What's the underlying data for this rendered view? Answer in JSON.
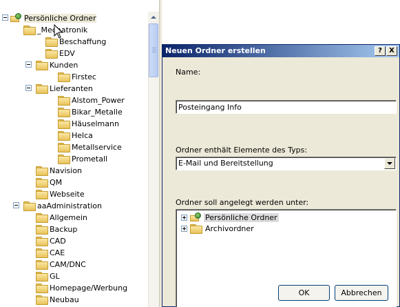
{
  "tree": {
    "items": [
      {
        "label": "Persönliche Ordner",
        "icon": "pst-icon",
        "expander": "minus"
      },
      {
        "label": "_Mechatronik",
        "icon": "folder-icon",
        "expander": "minus"
      },
      {
        "label": "Beschaffung",
        "icon": "folder-icon"
      },
      {
        "label": "EDV",
        "icon": "folder-icon"
      },
      {
        "label": "Kunden",
        "icon": "folder-icon",
        "expander": "minus"
      },
      {
        "label": "Firstec",
        "icon": "folder-icon"
      },
      {
        "label": "Lieferanten",
        "icon": "folder-icon",
        "expander": "minus"
      },
      {
        "label": "Alstom_Power",
        "icon": "folder-icon"
      },
      {
        "label": "Bikar_Metalle",
        "icon": "folder-icon"
      },
      {
        "label": "Häuselmann",
        "icon": "folder-icon"
      },
      {
        "label": "Helca",
        "icon": "folder-icon"
      },
      {
        "label": "Metallservice",
        "icon": "folder-icon"
      },
      {
        "label": "Prometall",
        "icon": "folder-icon"
      },
      {
        "label": "Navision",
        "icon": "folder-icon"
      },
      {
        "label": "QM",
        "icon": "folder-icon"
      },
      {
        "label": "Webseite",
        "icon": "folder-icon"
      },
      {
        "label": "aaAdministration",
        "icon": "folder-icon",
        "expander": "minus"
      },
      {
        "label": "Allgemein",
        "icon": "folder-icon"
      },
      {
        "label": "Backup",
        "icon": "folder-icon"
      },
      {
        "label": "CAD",
        "icon": "folder-icon"
      },
      {
        "label": "CAE",
        "icon": "folder-icon"
      },
      {
        "label": "CAM/DNC",
        "icon": "folder-icon"
      },
      {
        "label": "GL",
        "icon": "folder-icon"
      },
      {
        "label": "Homepage/Werbung",
        "icon": "folder-icon"
      },
      {
        "label": "Neubau",
        "icon": "folder-icon"
      }
    ]
  },
  "dialog": {
    "title": "Neuen Ordner erstellen",
    "help_label": "?",
    "close_label": "X",
    "name_label": "Name:",
    "name_value": "Posteingang Info",
    "type_label": "Ordner enthält Elemente des Typs:",
    "type_value": "E-Mail und Bereitstellung",
    "dest_label": "Ordner soll angelegt werden unter:",
    "dest_items": [
      {
        "label": "Persönliche Ordner",
        "icon": "pst-icon",
        "selected": true
      },
      {
        "label": "Archivordner",
        "icon": "archive-folder-icon",
        "selected": false
      }
    ],
    "ok_label": "OK",
    "cancel_label": "Abbrechen"
  },
  "colors": {
    "title_start": "#0a246a",
    "title_end": "#a6caf0",
    "dialog_bg": "#ece9d8"
  }
}
